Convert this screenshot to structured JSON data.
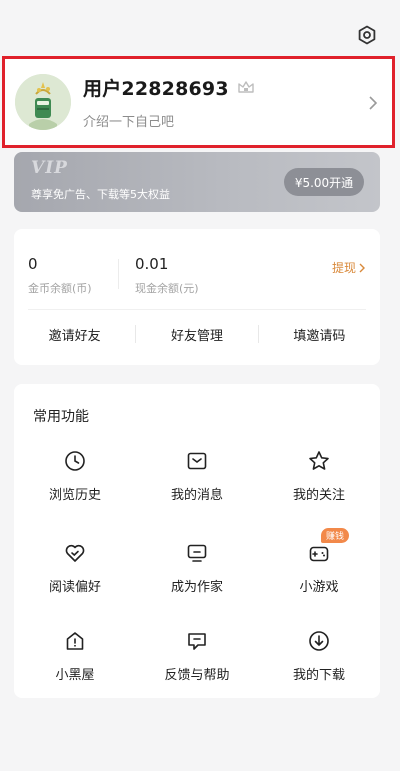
{
  "profile": {
    "username": "用户22828693",
    "bio": "介绍一下自己吧"
  },
  "vip": {
    "title": "VIP",
    "description": "尊享免广告、下载等5大权益",
    "button": "¥5.00开通"
  },
  "wallet": {
    "coins_value": "0",
    "coins_label": "金币余额(币)",
    "cash_value": "0.01",
    "cash_label": "现金余额(元)",
    "withdraw": "提现",
    "actions": [
      "邀请好友",
      "好友管理",
      "填邀请码"
    ]
  },
  "functions": {
    "title": "常用功能",
    "items": [
      {
        "label": "浏览历史",
        "icon": "clock-icon"
      },
      {
        "label": "我的消息",
        "icon": "message-icon"
      },
      {
        "label": "我的关注",
        "icon": "star-icon"
      },
      {
        "label": "阅读偏好",
        "icon": "heart-check-icon"
      },
      {
        "label": "成为作家",
        "icon": "monitor-icon"
      },
      {
        "label": "小游戏",
        "icon": "gamepad-icon",
        "badge": "赚钱"
      },
      {
        "label": "小黑屋",
        "icon": "house-alert-icon"
      },
      {
        "label": "反馈与帮助",
        "icon": "feedback-icon"
      },
      {
        "label": "我的下载",
        "icon": "download-icon"
      }
    ]
  },
  "colors": {
    "highlight_border": "#e0212b",
    "withdraw": "#d9893a",
    "badge": "#f2894a"
  }
}
